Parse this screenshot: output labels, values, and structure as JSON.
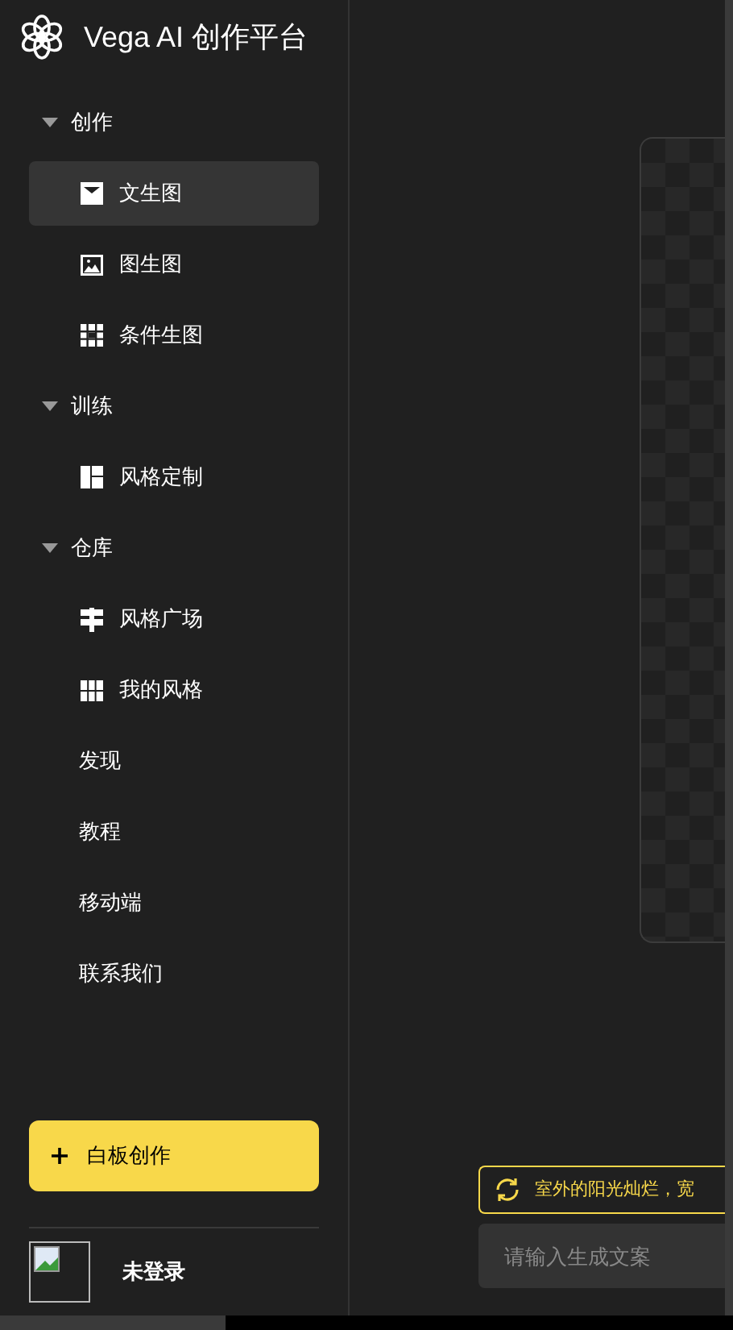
{
  "brand": {
    "title": "Vega AI 创作平台"
  },
  "nav": [
    {
      "kind": "group",
      "label": "创作",
      "expanded": true,
      "children": [
        {
          "label": "文生图",
          "selected": true
        },
        {
          "label": "图生图",
          "selected": false
        },
        {
          "label": "条件生图",
          "selected": false
        }
      ]
    },
    {
      "kind": "group",
      "label": "训练",
      "expanded": true,
      "children": [
        {
          "label": "风格定制",
          "selected": false
        }
      ]
    },
    {
      "kind": "group",
      "label": "仓库",
      "expanded": true,
      "children": [
        {
          "label": "风格广场",
          "selected": false
        },
        {
          "label": "我的风格",
          "selected": false
        }
      ]
    },
    {
      "kind": "link",
      "label": "发现",
      "selected": false
    },
    {
      "kind": "link",
      "label": "教程",
      "selected": false
    },
    {
      "kind": "link",
      "label": "移动端",
      "selected": false
    },
    {
      "kind": "link",
      "label": "联系我们",
      "selected": false
    }
  ],
  "create_button": {
    "label": "白板创作"
  },
  "user": {
    "name": "未登录"
  },
  "prompt": {
    "suggestion": "室外的阳光灿烂，宽",
    "placeholder": "请输入生成文案"
  }
}
